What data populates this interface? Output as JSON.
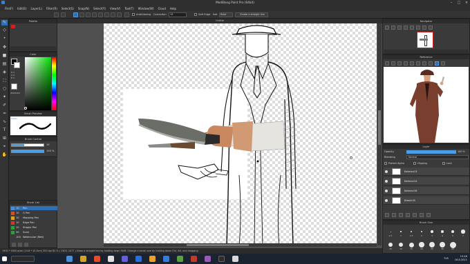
{
  "window": {
    "title": "MediBang Paint Pro (64bit)"
  },
  "menu": [
    "File(F)",
    "Edit(E)",
    "Layer(L)",
    "Filter(R)",
    "Select(S)",
    "Snap(N)",
    "Select(Y)",
    "View(V)",
    "Tool(T)",
    "Window(W)",
    "Cloud",
    "Help"
  ],
  "toolbar": {
    "antialiasing": "AntiAliasing",
    "correction_label": "Correction",
    "correction_value": "15",
    "soft_edge": "Soft Edge",
    "no_label": "Not",
    "ruler_button": "Ruler",
    "straight_line": "Create a straight line"
  },
  "canvas": {
    "doc_title": "Untitle"
  },
  "panels": {
    "palette": "Palette",
    "color": "Color",
    "color_hex": "#000000",
    "rgb": [
      "R 0",
      "G 0",
      "B 0"
    ],
    "brush_preview": "Brush Preview",
    "brush_preview_name": "G-Pen",
    "brush_control": "Brush Control",
    "brush_size": "10",
    "brush_opacity": "100 %",
    "brush_list": "Brush List",
    "navigator": "Navigator",
    "reference": "Reference",
    "layer": "Layer",
    "brush_size_panel": "Brush Size"
  },
  "brushes": [
    {
      "key": "10",
      "name": "Pen",
      "color": "#4a8ed8",
      "selected": true
    },
    {
      "key": "10",
      "name": "G Pen",
      "color": "#d94d2b"
    },
    {
      "key": "10",
      "name": "Mapping Pen",
      "color": "#d9a02b"
    },
    {
      "key": "10",
      "name": "Edge Pen",
      "color": "#c73b3b"
    },
    {
      "key": "10",
      "name": "Stipple Pen",
      "color": "#2d9b3e"
    },
    {
      "key": "50",
      "name": "Sumi",
      "color": "#2d9b3e"
    },
    {
      "key": "100",
      "name": "Watercolor (Wet)",
      "color": "#3a3a3a"
    }
  ],
  "layer": {
    "opacity_label": "Opacity",
    "opacity_value": "100 %",
    "blending_label": "Blending",
    "blending_value": "Normal",
    "protect_alpha": "Protect Alpha",
    "clipping": "Clipping",
    "lock": "Lock",
    "layers": [
      "Katman13",
      "Katman14",
      "Katman16",
      "Klasör18"
    ]
  },
  "brush_size_values": [
    "0.7",
    "1",
    "1.5",
    "2",
    "3",
    "4",
    "5",
    "7",
    "10",
    "12",
    "15",
    "20",
    "25",
    "30",
    "40"
  ],
  "status": "1900 * 1800 pixel   (10.8 * 10.3cm)   350 dpi   62 %   ( 1303, 1077 )   Draw a straight line by holding down Shift. Change a brush size by holding down Ctrl, Alt, and dragging",
  "clock": {
    "time": "15:46",
    "date": "16.8.2021",
    "lang": "TUR"
  }
}
